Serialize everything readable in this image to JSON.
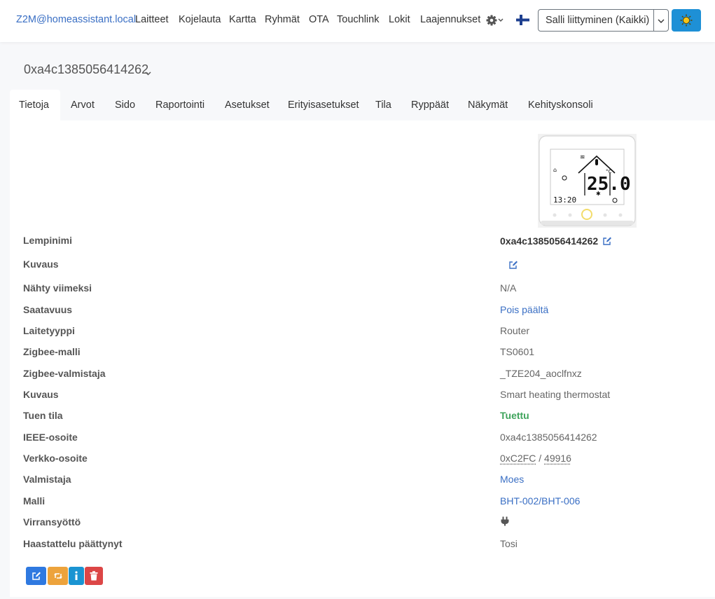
{
  "navbar": {
    "brand": "Z2M@homeassistant.local",
    "links": [
      "Laitteet",
      "Kojelauta",
      "Kartta",
      "Ryhmät",
      "OTA",
      "Touchlink",
      "Lokit",
      "Laajennukset"
    ],
    "settings_icon": "gear-icon",
    "language_icon": "finnish-flag-icon",
    "permit_join_label": "Salli liittyminen (Kaikki)",
    "theme_icon": "sun-icon"
  },
  "device": {
    "title": "0xa4c1385056414262"
  },
  "tabs": [
    "Tietoja",
    "Arvot",
    "Sido",
    "Raportointi",
    "Asetukset",
    "Erityisasetukset",
    "Tila",
    "Ryppäät",
    "Näkymät",
    "Kehityskonsoli"
  ],
  "active_tab": "Tietoja",
  "thermostat_display": {
    "temperature": "25.0",
    "unit": "°C",
    "clock": "13:20"
  },
  "info": {
    "nickname": {
      "label": "Lempinimi",
      "value": "0xa4c1385056414262"
    },
    "description": {
      "label": "Kuvaus",
      "value": ""
    },
    "last_seen": {
      "label": "Nähty viimeksi",
      "value": "N/A"
    },
    "availability": {
      "label": "Saatavuus",
      "value": "Pois päältä"
    },
    "device_type": {
      "label": "Laitetyyppi",
      "value": "Router"
    },
    "zigbee_model": {
      "label": "Zigbee-malli",
      "value": "TS0601"
    },
    "zigbee_manufacturer": {
      "label": "Zigbee-valmistaja",
      "value": "_TZE204_aoclfnxz"
    },
    "zigbee_description": {
      "label": "Kuvaus",
      "value": "Smart heating thermostat"
    },
    "support_status": {
      "label": "Tuen tila",
      "value": "Tuettu"
    },
    "ieee_address": {
      "label": "IEEE-osoite",
      "value": "0xa4c1385056414262"
    },
    "network_address": {
      "label": "Verkko-osoite",
      "hex": "0xC2FC",
      "separator": " / ",
      "dec": "49916"
    },
    "vendor": {
      "label": "Valmistaja",
      "value": "Moes"
    },
    "model": {
      "label": "Malli",
      "value": "BHT-002/BHT-006"
    },
    "power_source": {
      "label": "Virransyöttö",
      "icon": "plug-icon"
    },
    "interview_completed": {
      "label": "Haastattelu päättynyt",
      "value": "Tosi"
    }
  },
  "actions": [
    {
      "name": "rename",
      "icon": "edit-icon",
      "color": "#2f79e0"
    },
    {
      "name": "reconfigure",
      "icon": "retweet-icon",
      "color": "#eda33c"
    },
    {
      "name": "interview",
      "icon": "info-icon",
      "color": "#1a94d2"
    },
    {
      "name": "remove",
      "icon": "trash-icon",
      "color": "#dc4646"
    }
  ]
}
